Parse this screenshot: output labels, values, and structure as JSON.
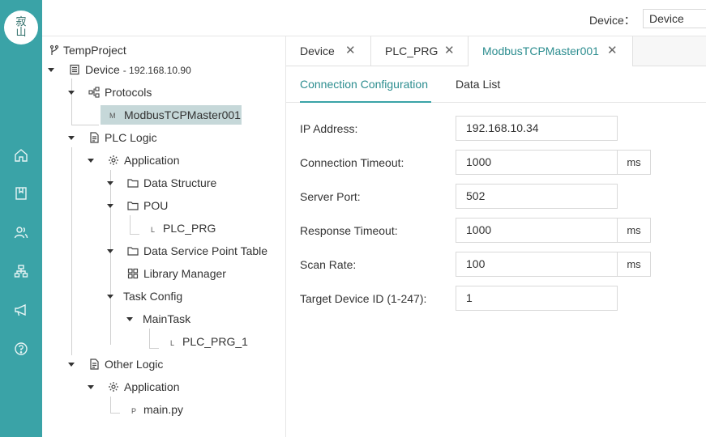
{
  "logo": {
    "char_top": "寂",
    "char_bottom": "山"
  },
  "sidebar": {
    "icons": [
      "home-icon",
      "book-icon",
      "users-icon",
      "network-icon",
      "megaphone-icon",
      "help-icon"
    ]
  },
  "topbar": {
    "device_label": "Device：",
    "device_value": "Device"
  },
  "tree": {
    "project": "TempProject",
    "device": "Device",
    "device_ip": "- 192.168.10.90",
    "protocols": "Protocols",
    "modbus_prefix": "M",
    "modbus": "ModbusTCPMaster001",
    "plc_logic": "PLC Logic",
    "application": "Application",
    "data_structure": "Data Structure",
    "pou": "POU",
    "plc_prg_prefix": "L",
    "plc_prg": "PLC_PRG",
    "data_service": "Data Service Point Table",
    "library_manager": "Library Manager",
    "task_config": "Task Config",
    "main_task": "MainTask",
    "plc_prg_1_prefix": "L",
    "plc_prg_1": "PLC_PRG_1",
    "other_logic": "Other Logic",
    "application2": "Application",
    "main_py_prefix": "P",
    "main_py": "main.py"
  },
  "tabs": [
    {
      "label": "Device",
      "close": "✕"
    },
    {
      "label": "PLC_PRG",
      "close": "✕"
    },
    {
      "label": "ModbusTCPMaster001",
      "close": "✕"
    }
  ],
  "subtabs": {
    "connection": "Connection Configuration",
    "data_list": "Data List"
  },
  "form": {
    "ip_label": "IP Address:",
    "ip_value": "192.168.10.34",
    "conn_timeout_label": "Connection Timeout:",
    "conn_timeout_value": "1000",
    "conn_timeout_unit": "ms",
    "server_port_label": "Server Port:",
    "server_port_value": "502",
    "resp_timeout_label": "Response Timeout:",
    "resp_timeout_value": "1000",
    "resp_timeout_unit": "ms",
    "scan_rate_label": "Scan Rate:",
    "scan_rate_value": "100",
    "scan_rate_unit": "ms",
    "target_id_label": "Target Device ID (1-247):",
    "target_id_value": "1"
  },
  "colors": {
    "accent": "#3aa3a7",
    "active_text": "#2c8d8f",
    "selected_bg": "#c6d8d9"
  }
}
